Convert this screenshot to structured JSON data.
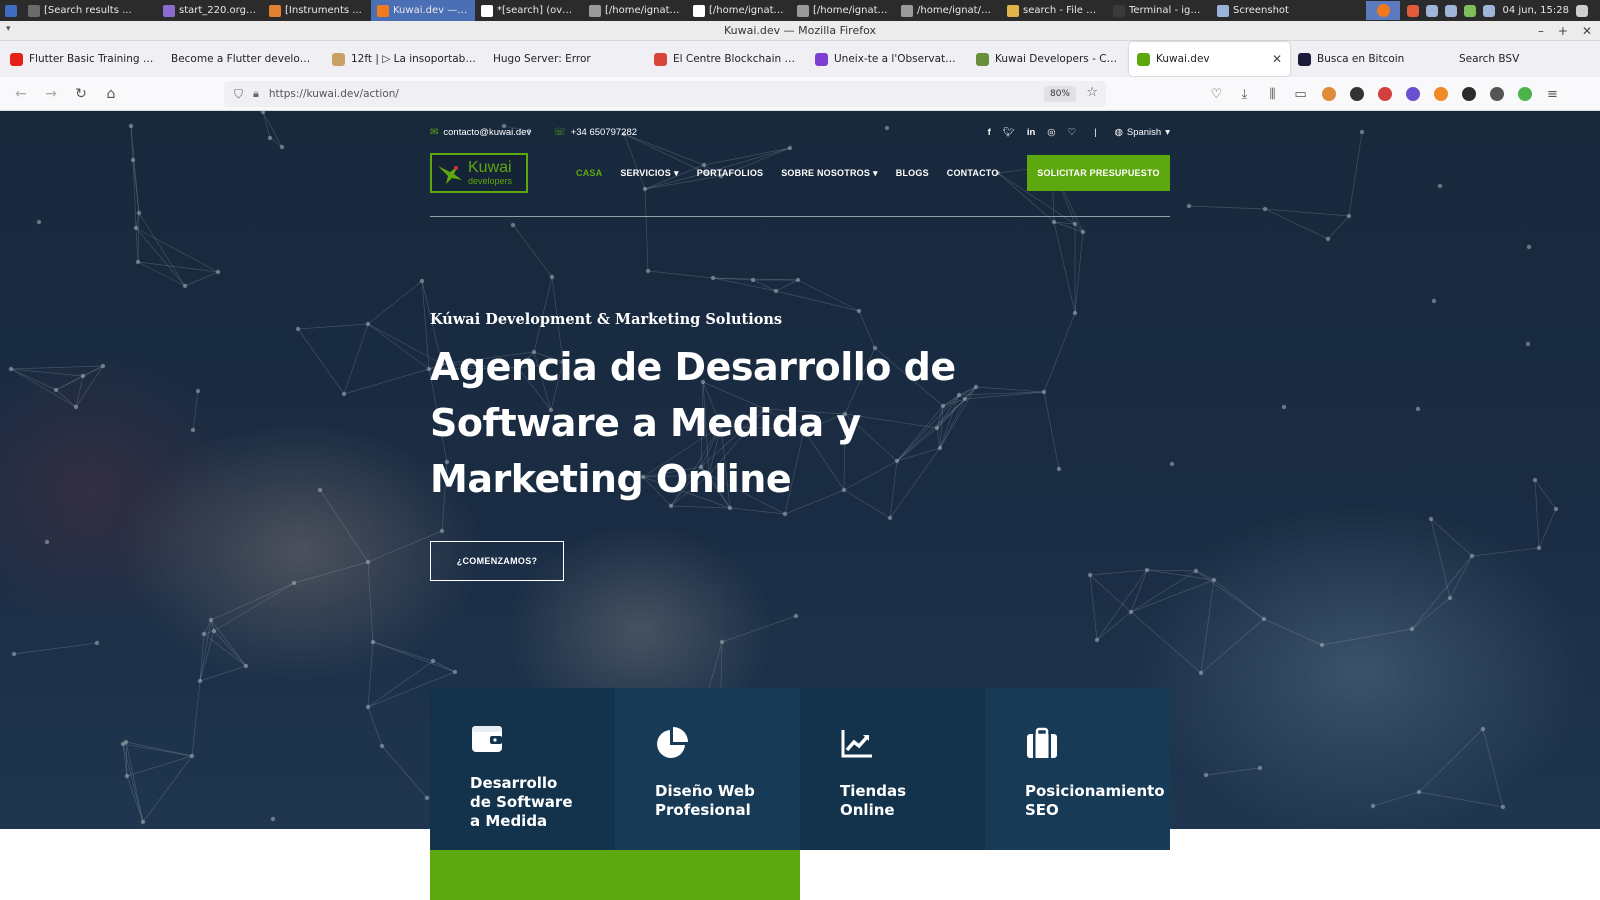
{
  "taskbar": {
    "tasks": [
      {
        "label": "[Search results ..."
      },
      {
        "label": "start_220.org-b..."
      },
      {
        "label": "[Instruments ..."
      },
      {
        "label": "Kuwai.dev — M...",
        "active": true
      },
      {
        "label": "*[search] (over..."
      },
      {
        "label": "[/home/ignat/D..."
      },
      {
        "label": "[/home/ignat/D..."
      },
      {
        "label": "[/home/ignat/D..."
      },
      {
        "label": "/home/ignat/D..."
      },
      {
        "label": "search - File M..."
      },
      {
        "label": "Terminal - ignat..."
      },
      {
        "label": "Screenshot"
      }
    ],
    "clock": "04 jun, 15:28"
  },
  "window": {
    "title": "Kuwai.dev — Mozilla Firefox",
    "minimize": "–",
    "maximize": "+",
    "close": "✕"
  },
  "tabs": [
    {
      "label": "Flutter Basic Training - 12",
      "fav_color": "#e62117"
    },
    {
      "label": "Become a Flutter developer —",
      "fav_color": ""
    },
    {
      "label": "12ft | ▷ La insoportable m",
      "fav_color": "#c9a064"
    },
    {
      "label": "Hugo Server: Error",
      "fav_color": ""
    },
    {
      "label": "El Centre Blockchain de C",
      "fav_color": "#d9453b"
    },
    {
      "label": "Uneix-te a l'Observatori B",
      "fav_color": "#7b3fd1"
    },
    {
      "label": "Kuwai Developers - CBCat",
      "fav_color": "#6a8f3a"
    },
    {
      "label": "Kuwai.dev",
      "fav_color": "#5ea80f",
      "active": true,
      "close": "✕"
    },
    {
      "label": "Busca en Bitcoin",
      "fav_color": "#1b1b3a"
    },
    {
      "label": "Search BSV",
      "fav_color": ""
    }
  ],
  "nav": {
    "url": "https://kuwai.dev/action/",
    "zoom": "80%"
  },
  "site": {
    "email": "contacto@kuwai.dev",
    "phone": "+34 650797282",
    "language": "Spanish",
    "logo": {
      "line1": "Kuwai",
      "line2": "developers"
    },
    "menu": [
      {
        "label": "CASA",
        "active": true,
        "dropdown": false
      },
      {
        "label": "SERVICIOS",
        "active": false,
        "dropdown": true
      },
      {
        "label": "PORTAFOLIOS",
        "active": false,
        "dropdown": false
      },
      {
        "label": "SOBRE NOSOTROS",
        "active": false,
        "dropdown": true
      },
      {
        "label": "BLOGS",
        "active": false,
        "dropdown": false
      },
      {
        "label": "CONTACTO",
        "active": false,
        "dropdown": false
      }
    ],
    "quote_button": "SOLICITAR PRESUPUESTO",
    "tagline": "Kúwai Development & Marketing Solutions",
    "headline": "Agencia de Desarrollo de Software a Medida y Marketing Online",
    "cta": "¿COMENZAMOS?",
    "services": [
      {
        "title": "Desarrollo\nde Software\na Medida",
        "icon": "wallet-icon",
        "bg": "#13334d"
      },
      {
        "title": "Diseño Web\nProfesional",
        "icon": "pie-chart-icon",
        "bg": "#173a57"
      },
      {
        "title": "Tiendas\nOnline",
        "icon": "chart-line-icon",
        "bg": "#13334d"
      },
      {
        "title": "Posicionamiento\nSEO",
        "icon": "briefcase-icon",
        "bg": "#173a57"
      }
    ]
  },
  "colors": {
    "accent_green": "#5ea80f",
    "service_dark": "#13334d",
    "service_light": "#173a57"
  }
}
